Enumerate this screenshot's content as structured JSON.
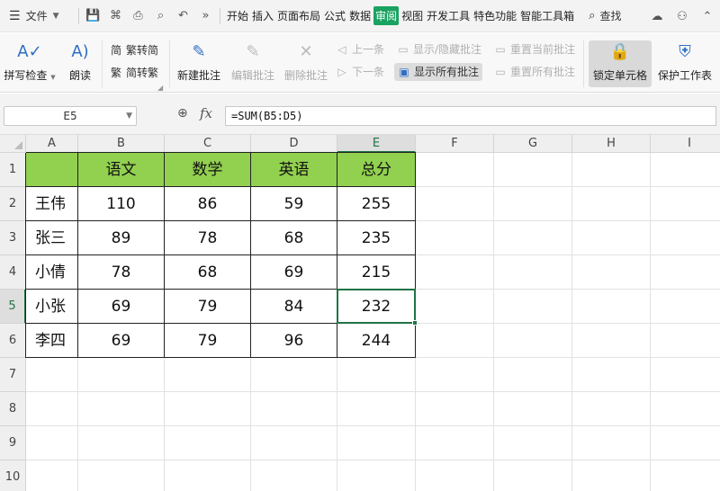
{
  "menubar": {
    "file_label": "文件",
    "tabs": [
      "开始",
      "插入",
      "页面布局",
      "公式",
      "数据",
      "审阅",
      "视图",
      "开发工具",
      "特色功能",
      "智能工具箱"
    ],
    "active_tab": "审阅",
    "search_label": "查找"
  },
  "ribbon": {
    "spellcheck": "拼写检查",
    "read_aloud": "朗读",
    "to_traditional": "繁转简",
    "to_simplified": "简转繁",
    "new_comment": "新建批注",
    "edit_comment": "编辑批注",
    "delete_comment": "删除批注",
    "prev": "上一条",
    "next": "下一条",
    "show_hide_comment": "显示/隐藏批注",
    "show_all_comments": "显示所有批注",
    "reset_current": "重置当前批注",
    "reset_all": "重置所有批注",
    "lock_cell": "锁定单元格",
    "protect_sheet": "保护工作表"
  },
  "formula_bar": {
    "name_box": "E5",
    "fx": "fx",
    "formula": "=SUM(B5:D5)"
  },
  "sheet": {
    "columns": [
      "A",
      "B",
      "C",
      "D",
      "E",
      "F",
      "G",
      "H",
      "I"
    ],
    "rows": [
      "1",
      "2",
      "3",
      "4",
      "5",
      "6",
      "7",
      "8",
      "9",
      "10"
    ],
    "selected_column": "E",
    "selected_row": "5",
    "header_fill": "#92d050",
    "table": [
      [
        "",
        "语文",
        "数学",
        "英语",
        "总分"
      ],
      [
        "王伟",
        "110",
        "86",
        "59",
        "255"
      ],
      [
        "张三",
        "89",
        "78",
        "68",
        "235"
      ],
      [
        "小倩",
        "78",
        "68",
        "69",
        "215"
      ],
      [
        "小张",
        "69",
        "79",
        "84",
        "232"
      ],
      [
        "李四",
        "69",
        "79",
        "96",
        "244"
      ]
    ]
  }
}
